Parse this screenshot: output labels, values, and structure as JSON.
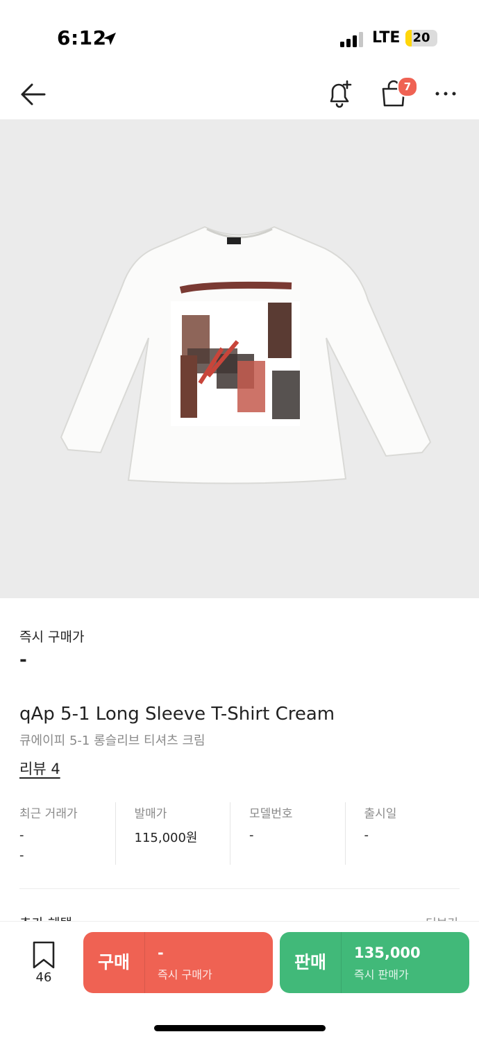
{
  "status": {
    "time": "6:12",
    "network": "LTE",
    "battery": "20",
    "battery_level": 0.2
  },
  "nav": {
    "cart_count": "7"
  },
  "product": {
    "image_alt": "",
    "instant_buy_label": "즉시 구매가",
    "instant_buy_price": "-",
    "title_en": "qAp 5-1 Long Sleeve T-Shirt Cream",
    "title_ko": "큐에이피 5-1 롱슬리브 티셔츠 크림",
    "review_label": "리뷰 4"
  },
  "info": [
    {
      "label": "최근 거래가",
      "value": "-",
      "value2": "-"
    },
    {
      "label": "발매가",
      "value": "115,000원"
    },
    {
      "label": "모델번호",
      "value": "-"
    },
    {
      "label": "출시일",
      "value": "-"
    }
  ],
  "peek": {
    "left": "추가 혜택",
    "right": "더보기"
  },
  "bottom": {
    "wish_count": "46",
    "buy": {
      "label": "구매",
      "price": "-",
      "sub": "즉시 구매가"
    },
    "sell": {
      "label": "판매",
      "price": "135,000",
      "sub": "즉시 판매가"
    }
  },
  "colors": {
    "buy": "#ef6253",
    "sell": "#41b979",
    "badge": "#ef6253",
    "image_bg": "#ebebeb"
  }
}
